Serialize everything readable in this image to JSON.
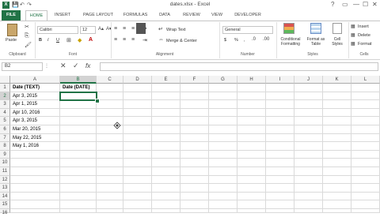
{
  "window": {
    "title": "dates.xlsx - Excel",
    "logo": "X",
    "qat": [
      "💾",
      "↶",
      "↷"
    ],
    "controls": [
      "?",
      "▭",
      "—",
      "☐",
      "✕"
    ]
  },
  "tabs": [
    "FILE",
    "HOME",
    "INSERT",
    "PAGE LAYOUT",
    "FORMULAS",
    "DATA",
    "REVIEW",
    "VIEW",
    "DEVELOPER"
  ],
  "ribbon": {
    "clipboard": {
      "paste": "Paste",
      "label": "Clipboard"
    },
    "font": {
      "name": "Calibri",
      "size": "12",
      "label": "Font",
      "bold": "B",
      "italic": "I",
      "underline": "U"
    },
    "alignment": {
      "wrap": "Wrap Text",
      "merge": "Merge & Center",
      "label": "Alignment"
    },
    "number": {
      "format": "General",
      "currency": "$",
      "percent": "%",
      "comma": ",",
      "label": "Number"
    },
    "styles": {
      "conditional": "Conditional",
      "formatting": "Formatting",
      "format_as": "Format as",
      "table": "Table",
      "cell": "Cell",
      "cell_styles": "Styles",
      "label": "Styles"
    },
    "cells": {
      "insert": "Insert",
      "delete": "Delete",
      "format": "Format",
      "label": "Cells"
    }
  },
  "formula_bar": {
    "name_box": "B2",
    "cancel": "✕",
    "enter": "✓",
    "fx": "fx",
    "value": ""
  },
  "sheet": {
    "columns": [
      "A",
      "B",
      "C",
      "D",
      "E",
      "F",
      "G",
      "H",
      "I",
      "J",
      "K",
      "L"
    ],
    "rows": [
      "1",
      "2",
      "3",
      "4",
      "5",
      "6",
      "7",
      "8",
      "9",
      "10",
      "11",
      "12",
      "13",
      "14",
      "15",
      "16"
    ],
    "header_a": "Date (TEXT)",
    "header_b": "Date (DATE)",
    "values_a": [
      "Apr 3, 2015",
      "Apr 1, 2015",
      "Apr 10, 2016",
      "Apr 3, 2015",
      "Mar 20, 2015",
      "May 22, 2015",
      "May 1, 2016"
    ]
  }
}
